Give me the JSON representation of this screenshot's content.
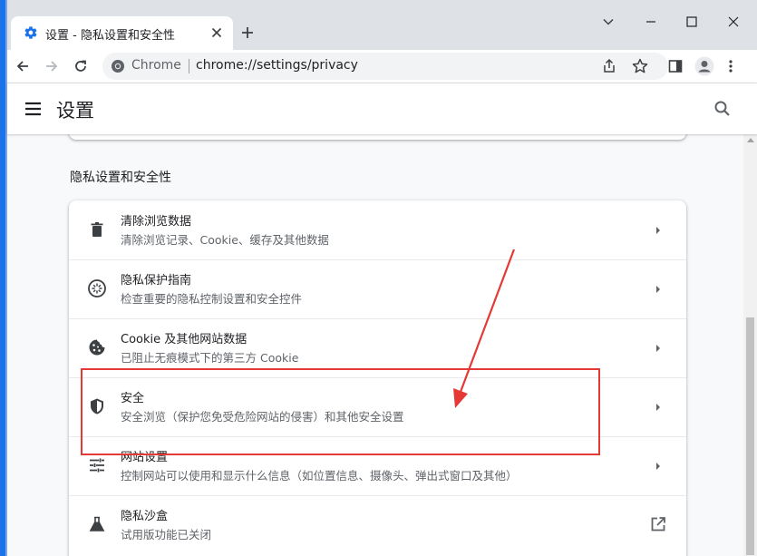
{
  "tab": {
    "title": "设置 - 隐私设置和安全性"
  },
  "toolbar": {
    "site_name": "Chrome",
    "url": "chrome://settings/privacy"
  },
  "header": {
    "title": "设置"
  },
  "section": {
    "title": "隐私设置和安全性"
  },
  "rows": [
    {
      "title": "清除浏览数据",
      "subtitle": "清除浏览记录、Cookie、缓存及其他数据",
      "icon": "trash-icon"
    },
    {
      "title": "隐私保护指南",
      "subtitle": "检查重要的隐私控制设置和安全控件",
      "icon": "privacy-guide-icon"
    },
    {
      "title": "Cookie 及其他网站数据",
      "subtitle": "已阻止无痕模式下的第三方 Cookie",
      "icon": "cookie-icon"
    },
    {
      "title": "安全",
      "subtitle": "安全浏览（保护您免受危险网站的侵害）和其他安全设置",
      "icon": "shield-icon"
    },
    {
      "title": "网站设置",
      "subtitle": "控制网站可以使用和显示什么信息（如位置信息、摄像头、弹出式窗口及其他）",
      "icon": "tune-icon"
    },
    {
      "title": "隐私沙盒",
      "subtitle": "试用版功能已关闭",
      "icon": "flask-icon"
    }
  ],
  "colors": {
    "accent": "#1a73e8",
    "annotation": "#e53935",
    "text_primary": "#202124",
    "text_secondary": "#5f6368"
  }
}
